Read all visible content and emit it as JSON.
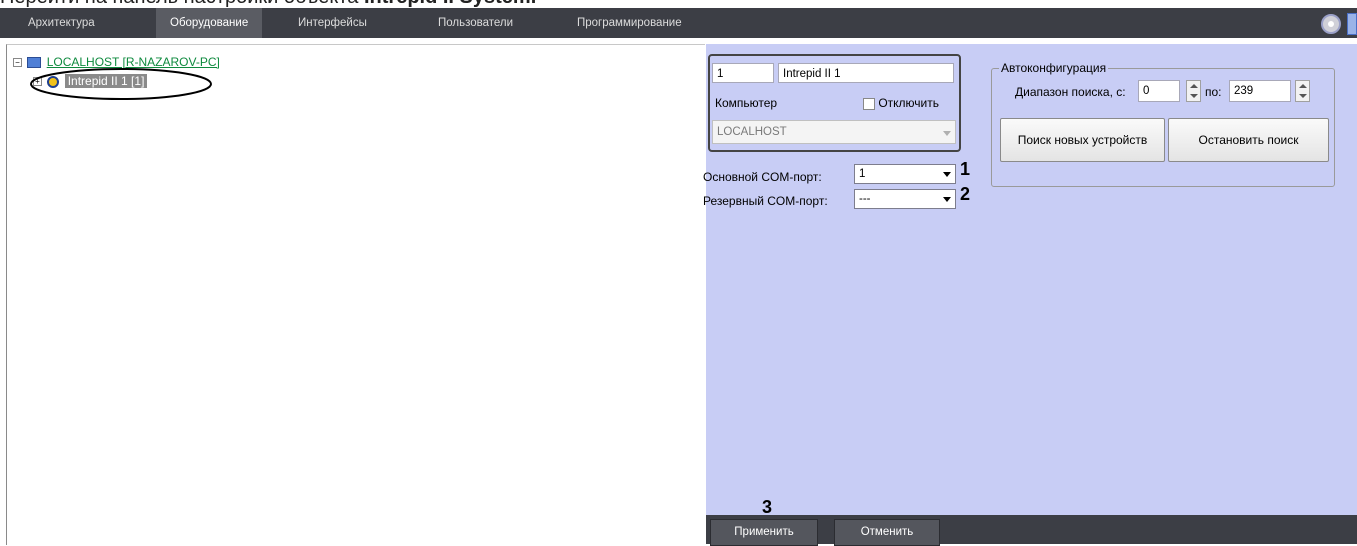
{
  "caption": {
    "prefix": "Перейти на панель настройки объекта ",
    "bold": "Intrepid II System."
  },
  "tabs": [
    "Архитектура",
    "Оборудование",
    "Интерфейсы",
    "Пользователи",
    "Программирование"
  ],
  "active_tab": "Оборудование",
  "tree": {
    "root_label": "LOCALHOST [R-NAZAROV-PC]",
    "child_label": "Intrepid II 1 [1]"
  },
  "object": {
    "id_value": "1",
    "name_value": "Intrepid II 1",
    "computer_label": "Компьютер",
    "disable_label": "Отключить",
    "computer_value": "LOCALHOST"
  },
  "autoconfig": {
    "title": "Автоконфигурация",
    "range_from_label": "Диапазон поиска, с:",
    "range_from_value": "0",
    "range_to_label": "по:",
    "range_to_value": "239",
    "search_button": "Поиск новых устройств",
    "stop_button": "Остановить поиск"
  },
  "ports": {
    "main_label": "Основной COM-порт:",
    "main_value": "1",
    "reserve_label": "Резервный COM-порт:",
    "reserve_value": "---"
  },
  "callouts": {
    "one": "1",
    "two": "2",
    "three": "3"
  },
  "footer": {
    "apply": "Применить",
    "cancel": "Отменить"
  },
  "colors": {
    "tabbar": "#3c3e45",
    "panel": "#c8cdf5",
    "tree_link": "#0e8a3e"
  }
}
